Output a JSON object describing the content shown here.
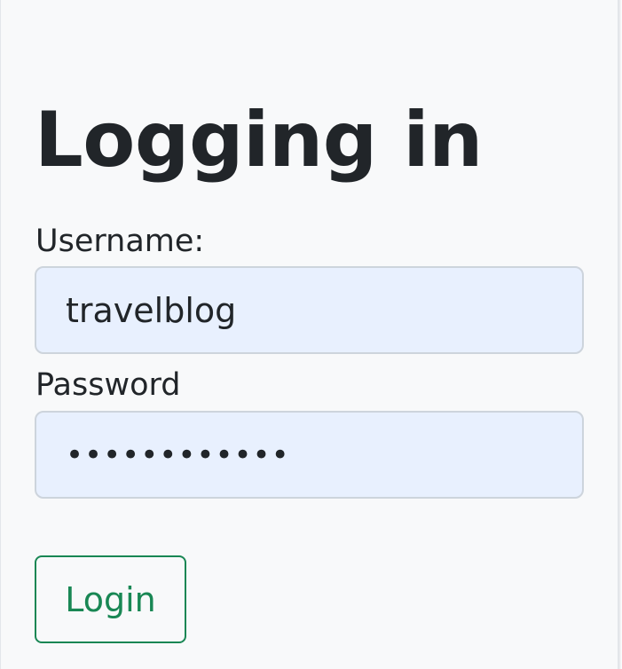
{
  "page": {
    "title": "Logging in"
  },
  "form": {
    "username_label": "Username:",
    "username_value": "travelblog",
    "password_label": "Password",
    "password_value": "••••••••••••",
    "login_label": "Login"
  },
  "colors": {
    "background": "#f8f9fa",
    "input_fill": "#e8f0fe",
    "input_border": "#cdd4dc",
    "accent_green": "#198754",
    "text": "#212529"
  }
}
